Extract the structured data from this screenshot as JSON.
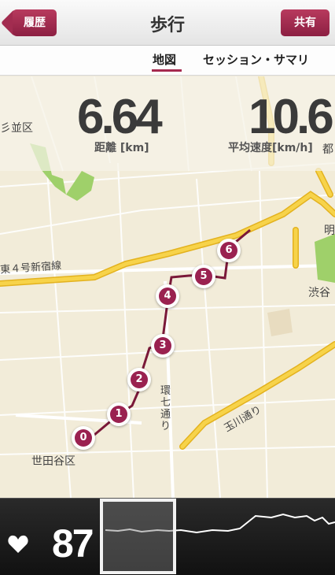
{
  "navbar": {
    "back_label": "履歴",
    "title": "歩行",
    "share_label": "共有"
  },
  "tabs": {
    "map": "地図",
    "summary": "セッション・サマリ"
  },
  "stats": {
    "distance_value": "6.64",
    "distance_label": "距離 [km]",
    "speed_value": "10.6",
    "speed_label": "平均速度[km/h]"
  },
  "map": {
    "labels": {
      "suginami": "彡並区",
      "route4": "東４号新宿線",
      "setagaya": "世田谷区",
      "shibuya": "渋谷",
      "kannana": "環七通り",
      "tamagawa": "玉川通り",
      "tsu": "都",
      "akira": "明"
    },
    "markers": [
      "0",
      "1",
      "2",
      "3",
      "4",
      "5",
      "6"
    ]
  },
  "heart_rate": {
    "value": "87",
    "icon": "heart-icon"
  },
  "colors": {
    "accent": "#9a2150",
    "route": "#7a1838",
    "road": "#f5c630",
    "park": "#9fd06a"
  }
}
